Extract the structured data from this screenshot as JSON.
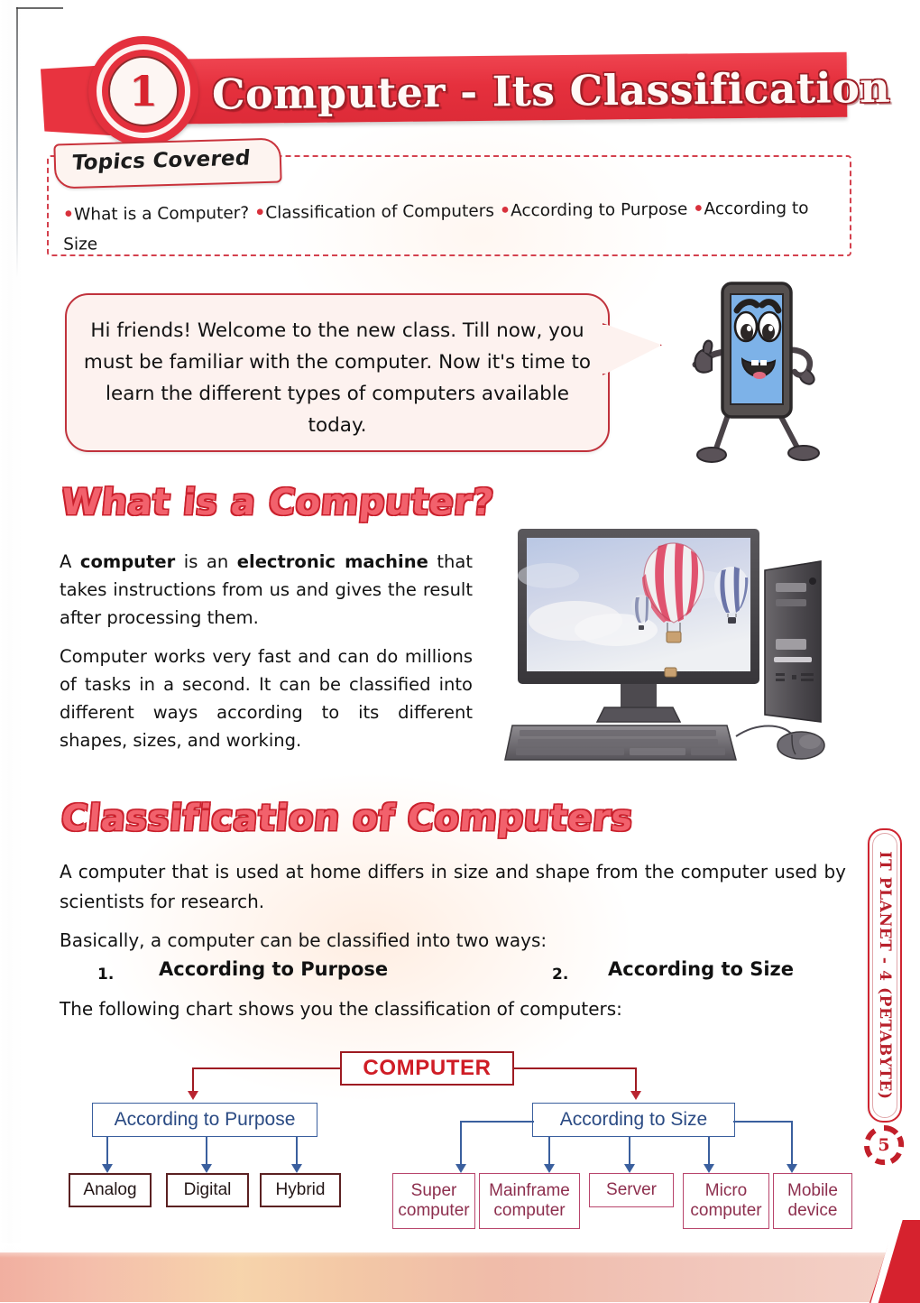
{
  "chapter": {
    "number": "1",
    "title": "Computer - Its Classification"
  },
  "topics": {
    "tab_label": "Topics Covered",
    "items": [
      "What is a Computer?",
      "Classification of Computers",
      "According to Purpose",
      "According to Size"
    ]
  },
  "bubble": {
    "text": "Hi friends! Welcome to the new class. Till now, you must be familiar with the computer. Now it's time to learn the different types of computers available today."
  },
  "sections": {
    "what_is_computer": {
      "heading": "What is a Computer?",
      "para1_a": "A ",
      "para1_b": "computer",
      "para1_c": " is an ",
      "para1_d": "electronic machine",
      "para1_e": " that takes instructions from us and gives the result after processing them.",
      "para2": "Computer works very fast and can do millions of tasks in a second. It can be classified into different ways according to its different shapes, sizes, and working.",
      "image_caption": "desktop-computer-illustration"
    },
    "classification": {
      "heading": "Classification of Computers",
      "para1": "A computer that is used at home differs in size and shape from the computer used by scientists for research.",
      "para2": "Basically, a computer can be classified into two ways:",
      "list": [
        {
          "num": "1.",
          "label": "According to Purpose"
        },
        {
          "num": "2.",
          "label": "According to Size"
        }
      ],
      "para3": "The following chart shows you the classification of computers:"
    }
  },
  "chart_data": {
    "type": "tree",
    "title": "Classification of computers",
    "root": "COMPUTER",
    "branches": [
      {
        "label": "According to Purpose",
        "children": [
          "Analog",
          "Digital",
          "Hybrid"
        ]
      },
      {
        "label": "According to Size",
        "children": [
          "Super computer",
          "Mainframe computer",
          "Server",
          "Micro computer",
          "Mobile device"
        ]
      }
    ],
    "nodes": {
      "root": "COMPUTER",
      "purpose": "According to Purpose",
      "size": "According to Size",
      "analog": "Analog",
      "digital": "Digital",
      "hybrid": "Hybrid",
      "super_1": "Super",
      "super_2": "computer",
      "mainframe_1": "Mainframe",
      "mainframe_2": "computer",
      "server": "Server",
      "micro_1": "Micro",
      "micro_2": "computer",
      "mobile_1": "Mobile",
      "mobile_2": "device"
    },
    "colors": {
      "root_border": "#9e1b22",
      "root_text": "#cf1d26",
      "branch_border": "#3a5f9e",
      "branch_text": "#2a4a83",
      "purpose_leaf_border": "#5b2122",
      "size_leaf_border": "#b8456c"
    }
  },
  "sidebar": {
    "book_label": "IT PLANET - 4 (PETABYTE)",
    "page_number": "5"
  },
  "theme": {
    "banner_red": "#e4303d",
    "heading_pink": "#f2616c",
    "heading_outline": "#c9202c",
    "bubble_bg": "#fdf2ef"
  }
}
